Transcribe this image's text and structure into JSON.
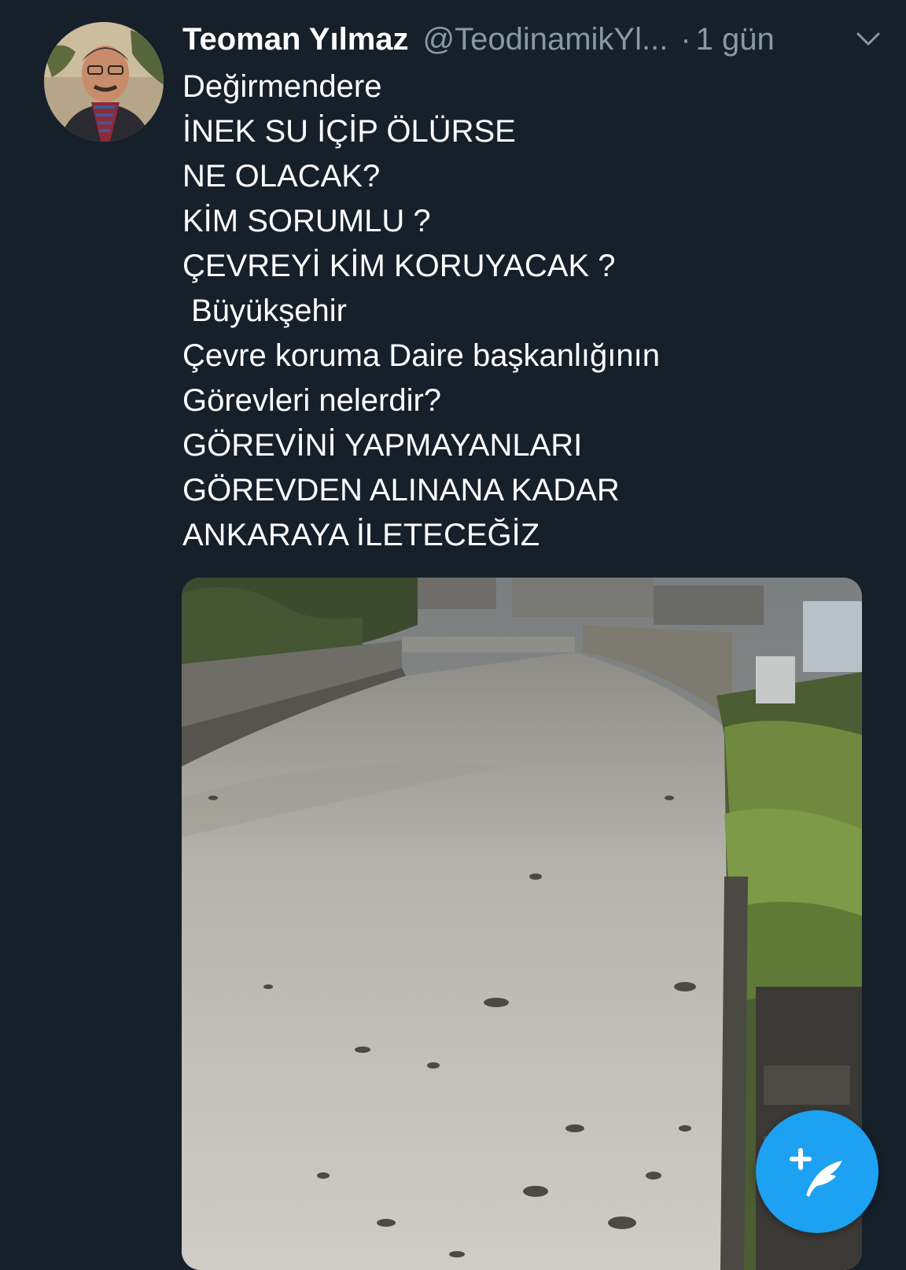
{
  "tweet": {
    "display_name": "Teoman Yılmaz",
    "handle": "@TeodinamikYl...",
    "separator": "·",
    "time": "1 gün",
    "text_lines": [
      "Değirmendere",
      "İNEK SU İÇİP ÖLÜRSE",
      "NE OLACAK?",
      "KİM SORUMLU ?",
      "ÇEVREYİ KİM KORUYACAK ?",
      " Büyükşehir",
      "Çevre koruma Daire başkanlığının",
      "Görevleri nelerdir?",
      "GÖREVİNİ YAPMAYANLARI",
      "GÖREVDEN ALINANA KADAR",
      "ANKARAYA İLETECEĞİZ"
    ]
  },
  "icons": {
    "menu": "chevron-down-icon",
    "compose": "compose-tweet-icon"
  },
  "colors": {
    "background": "#15202b",
    "secondary_text": "#8899a6",
    "accent": "#1da1f2"
  }
}
